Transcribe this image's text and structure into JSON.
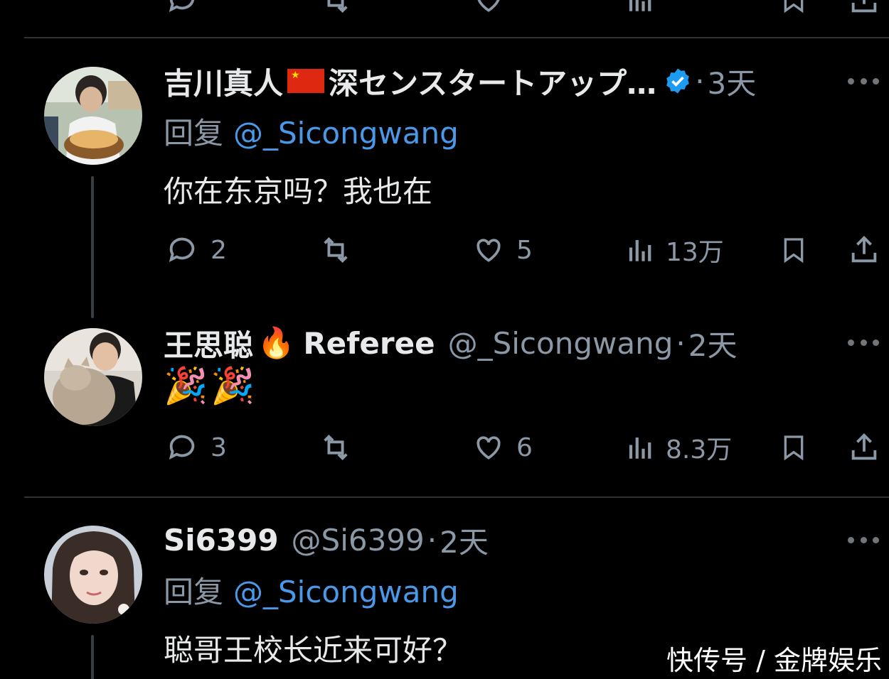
{
  "tweets": [
    {
      "display_name": "吉川真人",
      "flag": "CN",
      "name_suffix": "深センスタートアップ…",
      "verified": true,
      "time_separator": "·",
      "time": "3天",
      "reply_prefix": "回复",
      "reply_to": "@_Sicongwang",
      "text": "你在东京吗？我也在",
      "actions": {
        "reply": "2",
        "like": "5",
        "views": "13万"
      }
    },
    {
      "display_name": "王思聪",
      "emoji": "🔥",
      "name_suffix": "Referee",
      "handle": "@_Sicongwang",
      "time_separator": "·",
      "time": "2天",
      "text": "🎉🎉",
      "actions": {
        "reply": "3",
        "like": "6",
        "views": "8.3万"
      }
    },
    {
      "display_name": "Si6399",
      "handle": "@Si6399",
      "time_separator": "·",
      "time": "2天",
      "reply_prefix": "回复",
      "reply_to": "@_Sicongwang",
      "text": "聪哥王校长近来可好？"
    }
  ],
  "icons": {
    "reply": "speech-bubble-icon",
    "retweet": "retweet-icon",
    "like": "heart-icon",
    "views": "bar-chart-icon",
    "bookmark": "bookmark-icon",
    "share": "share-icon",
    "more": "more-dots-icon"
  },
  "colors": {
    "background": "#000000",
    "text": "#e7e9ea",
    "muted": "#8b98a5",
    "mention": "#4a99e9",
    "verified": "#1d9bf0"
  },
  "watermark": "快传号 / 金牌娱乐"
}
